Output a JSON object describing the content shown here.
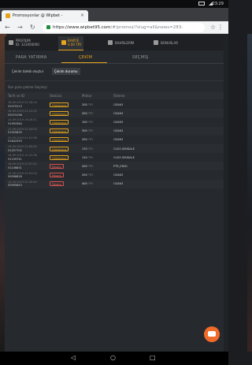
{
  "statusbar": {
    "time": "23:29"
  },
  "browser": {
    "tab_title": "Promosyonlar @ Wipbet -",
    "url_host": "https://www.wipbet95.com",
    "url_path": "/#/promos/?slug=all&news=283-"
  },
  "user": {
    "profile_label": "PROFİLİM",
    "profile_id": "ID: 123456000",
    "balance_label": "BAKİYE",
    "balance_value": "0.00 TRY",
    "bets_label": "BAHİSLERİM",
    "bonus_label": "BONUSLAR"
  },
  "subtabs": [
    "PARA YATIRMA",
    "ÇEKİM",
    "SEÇMİŞ"
  ],
  "active_subtab": "ÇEKİM",
  "buttons": {
    "requests": "Çekim talebi oluştur",
    "history": "Çekim durumu"
  },
  "section_title": "Son para çekme Geçmişi",
  "table": {
    "headers": [
      "Tarih ve ID",
      "Statüsü",
      "Miktar",
      "Ödeme"
    ],
    "rows": [
      {
        "date": "26.09.2019 21:30:24",
        "id": "52070213",
        "status": "Hükümsüz",
        "amount": "200",
        "cur": "TRY",
        "pay": "OZAN3"
      },
      {
        "date": "26.09.2019 21:12:52",
        "id": "52074198",
        "status": "Hükümsüz",
        "amount": "200",
        "cur": "TRY",
        "pay": "OZAN3"
      },
      {
        "date": "24.09.2019 19:28:21",
        "id": "51993384",
        "status": "Hükümsüz",
        "amount": "100",
        "cur": "TRY",
        "pay": "OZAN3"
      },
      {
        "date": "21.09.2019 21:04:03",
        "id": "51925835",
        "status": "Hükümsüz",
        "amount": "300",
        "cur": "TRY",
        "pay": "OZAN3"
      },
      {
        "date": "20.09.2019 01:01:58",
        "id": "51842555",
        "status": "Hükümsüz",
        "amount": "200",
        "cur": "TRY",
        "pay": "OZAN3"
      },
      {
        "date": "19.09.2019 21:00:40",
        "id": "51257702",
        "status": "Hükümsüz",
        "amount": "170",
        "cur": "TRY",
        "pay": "OLD3.SENDALE"
      },
      {
        "date": "18.09.2019 15:41:38",
        "id": "51159741",
        "status": "Hükümsüz",
        "amount": "110",
        "cur": "TRY",
        "pay": "OLD3.SENDALE"
      },
      {
        "date": "16.09.2019 20:57:42",
        "id": "51146831",
        "status": "Pasara",
        "amount": "200",
        "cur": "TRY",
        "pay": "PTR_ERIZI"
      },
      {
        "date": "15.09.2019 22:01:04",
        "id": "50998826",
        "status": "Pasara",
        "amount": "200",
        "cur": "TRY",
        "pay": "OZAN3"
      },
      {
        "date": "14.09.2019 22:20:40",
        "id": "50995843",
        "status": "Pasara",
        "amount": "400",
        "cur": "TRY",
        "pay": "OZAN3"
      }
    ]
  }
}
